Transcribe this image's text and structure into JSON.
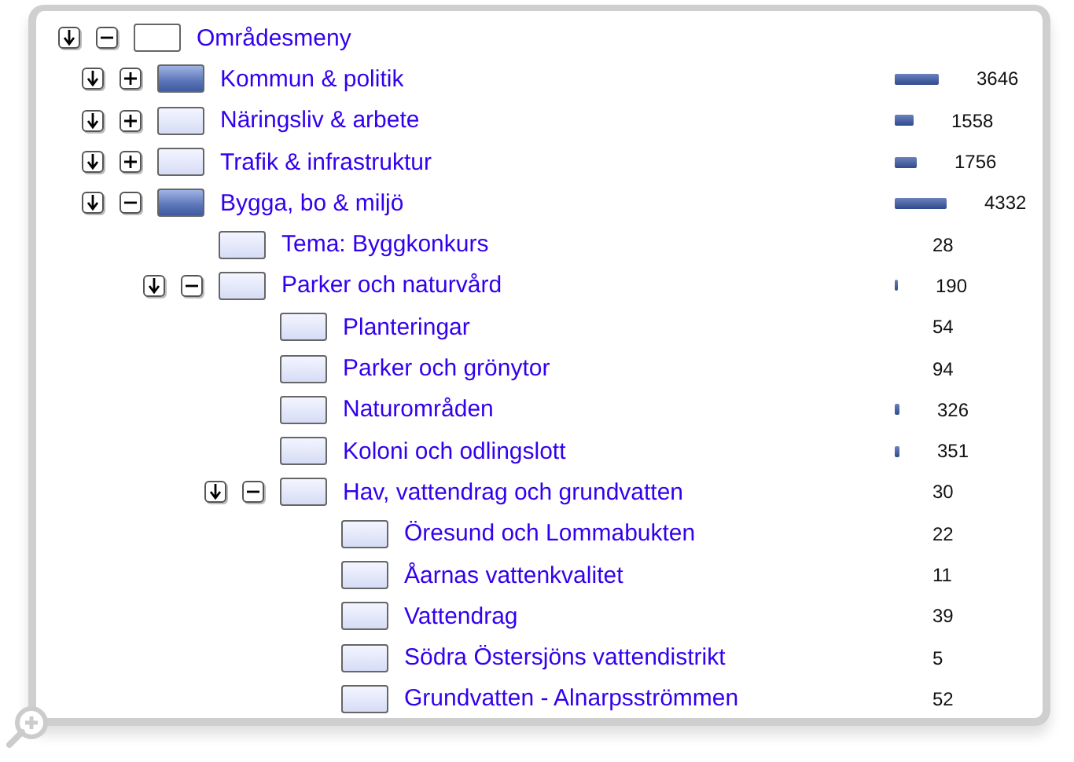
{
  "tree": {
    "label": "Områdesmeny",
    "expanded": true,
    "children": [
      {
        "label": "Kommun & politik",
        "expanded": false,
        "highlighted": true,
        "count": "3646"
      },
      {
        "label": "Näringsliv & arbete",
        "expanded": false,
        "highlighted": false,
        "count": "1558"
      },
      {
        "label": "Trafik & infrastruktur",
        "expanded": false,
        "highlighted": false,
        "count": "1756"
      },
      {
        "label": "Bygga, bo & miljö",
        "expanded": true,
        "highlighted": true,
        "count": "4332",
        "children": [
          {
            "label": "Tema: Byggkonkurs",
            "highlighted": false,
            "count": "28"
          },
          {
            "label": "Parker och naturvård",
            "expanded": true,
            "highlighted": false,
            "count": "190",
            "children": [
              {
                "label": "Planteringar",
                "highlighted": false,
                "count": "54"
              },
              {
                "label": "Parker och grönytor",
                "highlighted": false,
                "count": "94"
              },
              {
                "label": "Naturområden",
                "highlighted": false,
                "count": "326"
              },
              {
                "label": "Koloni och odlingslott",
                "highlighted": false,
                "count": "351"
              },
              {
                "label": "Hav, vattendrag och grundvatten",
                "expanded": true,
                "highlighted": false,
                "count": "30",
                "children": [
                  {
                    "label": "Öresund och Lommabukten",
                    "highlighted": false,
                    "count": "22"
                  },
                  {
                    "label": "Åarnas vattenkvalitet",
                    "highlighted": false,
                    "count": "11"
                  },
                  {
                    "label": "Vattendrag",
                    "highlighted": false,
                    "count": "39"
                  },
                  {
                    "label": "Södra Östersjöns vattendistrikt",
                    "highlighted": false,
                    "count": "5"
                  },
                  {
                    "label": "Grundvatten - Alnarpsströmmen",
                    "highlighted": false,
                    "count": "52"
                  }
                ]
              }
            ]
          }
        ]
      }
    ]
  }
}
